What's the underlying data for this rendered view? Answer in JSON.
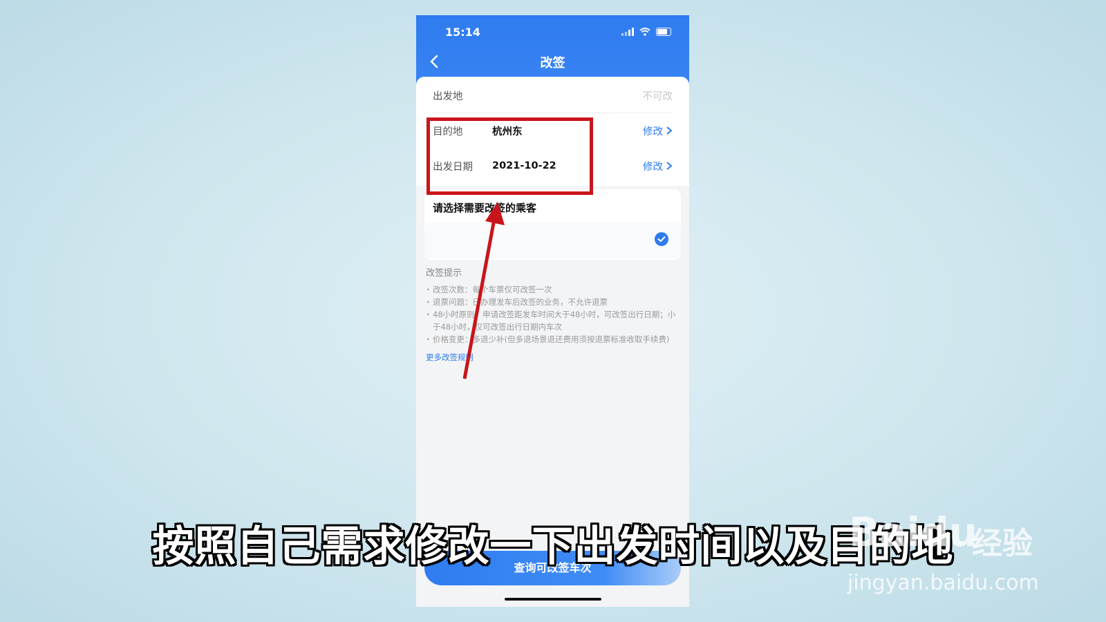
{
  "status_bar": {
    "time": "15:14"
  },
  "header": {
    "title": "改签"
  },
  "form": {
    "origin": {
      "label": "出发地",
      "note": "不可改"
    },
    "destination": {
      "label": "目的地",
      "value": "杭州东",
      "action": "修改"
    },
    "date": {
      "label": "出发日期",
      "value": "2021-10-22",
      "action": "修改"
    }
  },
  "passengers": {
    "title": "请选择需要改签的乘客"
  },
  "tips": {
    "title": "改签提示",
    "items": [
      "改签次数：每个车票仅可改签一次",
      "退票问题：已办理发车后改签的业务，不允许退票",
      "48小时原则：申请改签距发车时间大于48小时，可改签出行日期；小于48小时，仅可改签出行日期内车次",
      "价格变更：多退少补(但多退场景退还费用须按退票标准收取手续费)"
    ],
    "more": "更多改签规则"
  },
  "bottom_button": "查询可改签车次",
  "caption": "按照自己需求修改一下出发时间以及目的地",
  "watermark": {
    "logo": "Baidu",
    "cn": "经验",
    "url": "jingyan.baidu.com"
  },
  "colors": {
    "primary": "#2f7cf0",
    "annotation": "#c8151b"
  }
}
